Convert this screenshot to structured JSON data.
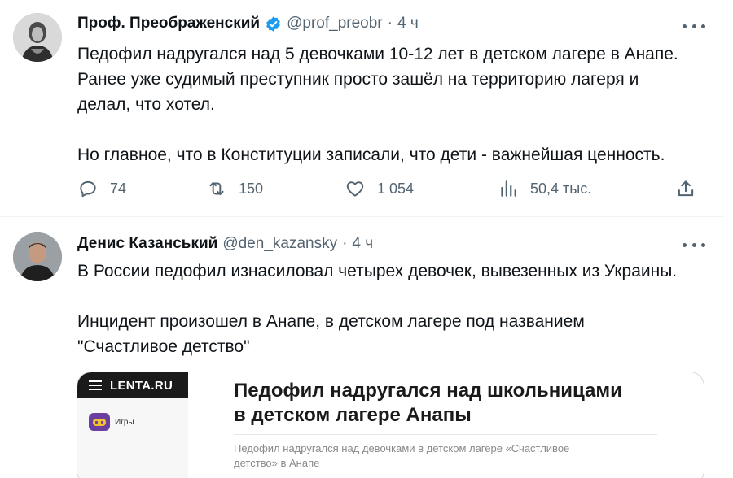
{
  "tweets": [
    {
      "author_name": "Проф. Преображенский",
      "verified": true,
      "handle": "@prof_preobr",
      "separator": "·",
      "time": "4 ч",
      "text_lines": [
        "Педофил надругался над 5 девочками 10-12 лет в детском лагере в Анапе.",
        "Ранее уже судимый преступник просто зашёл на территорию лагеря и",
        "делал, что хотел.",
        "Но главное, что в Конституции записали, что дети - важнейшая ценность."
      ],
      "actions": {
        "replies": "74",
        "retweets": "150",
        "likes": "1 054",
        "views": "50,4 тыс."
      }
    },
    {
      "author_name": "Денис Казанський",
      "handle": "@den_kazansky",
      "separator": "·",
      "time": "4 ч",
      "text_lines": [
        "В России педофил изнасиловал четырех девочек, вывезенных из Украины.",
        "Инцидент произошел в Анапе, в детском лагере под названием",
        "\"Счастливое детство\""
      ],
      "card": {
        "site_logo": "LENTA.RU",
        "games_label": "Игры",
        "title_line1": "Педофил надругался над школьницами",
        "title_line2": "в детском лагере Анапы",
        "subtitle_line1": "Педофил надругался над девочками в детском лагере «Счастливое",
        "subtitle_line2": "детство» в Анапе"
      }
    }
  ],
  "icons": [
    "verified-icon",
    "more-icon",
    "reply-icon",
    "retweet-icon",
    "like-icon",
    "views-icon",
    "share-icon",
    "menu-icon",
    "games-icon"
  ],
  "colors": {
    "text": "#0f1419",
    "secondary": "#536471",
    "verified": "#1d9bf0",
    "border": "#eff3f4"
  }
}
